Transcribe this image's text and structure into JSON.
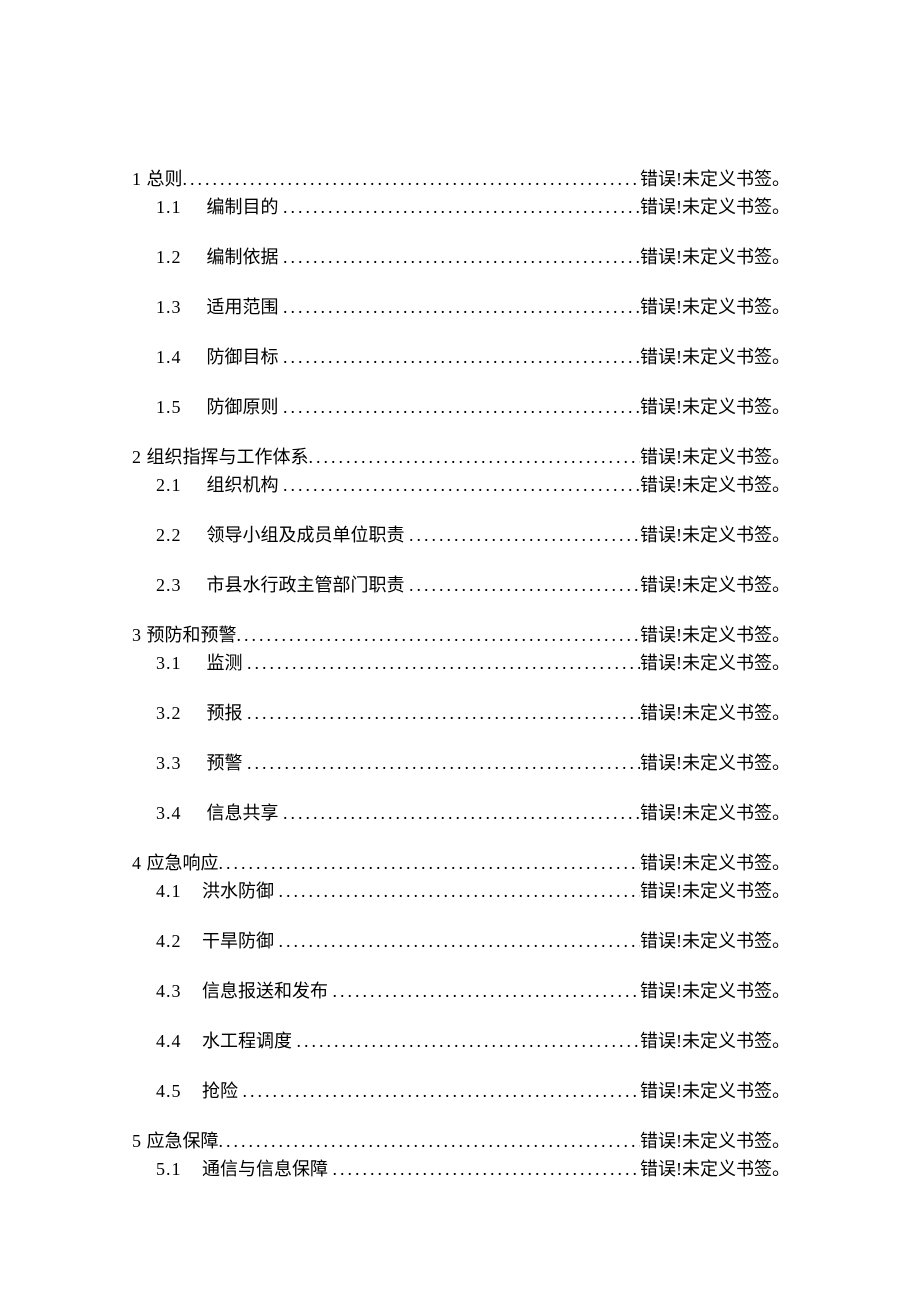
{
  "pageref_text": "错误!未定义书签。",
  "toc": [
    {
      "num": "1",
      "title": "总则",
      "level": 1
    },
    {
      "num": "1.1",
      "title": "编制目的",
      "level": 2
    },
    {
      "num": "1.2",
      "title": "编制依据",
      "level": 2
    },
    {
      "num": "1.3",
      "title": "适用范围",
      "level": 2
    },
    {
      "num": "1.4",
      "title": "防御目标",
      "level": 2
    },
    {
      "num": "1.5",
      "title": "防御原则",
      "level": 2
    },
    {
      "num": "2",
      "title": "组织指挥与工作体系",
      "level": 1
    },
    {
      "num": "2.1",
      "title": "组织机构",
      "level": 2
    },
    {
      "num": "2.2",
      "title": "领导小组及成员单位职责",
      "level": 2
    },
    {
      "num": "2.3",
      "title": "市县水行政主管部门职责",
      "level": 2
    },
    {
      "num": "3",
      "title": "预防和预警",
      "level": 1
    },
    {
      "num": "3.1",
      "title": "监测",
      "level": 2
    },
    {
      "num": "3.2",
      "title": "预报",
      "level": 2
    },
    {
      "num": "3.3",
      "title": "预警",
      "level": 2
    },
    {
      "num": "3.4",
      "title": "信息共享",
      "level": 2
    },
    {
      "num": "4",
      "title": "应急响应",
      "level": 1
    },
    {
      "num": "4.1",
      "title": "洪水防御",
      "level": 2,
      "tight": true
    },
    {
      "num": "4.2",
      "title": "干旱防御",
      "level": 2,
      "tight": true
    },
    {
      "num": "4.3",
      "title": "信息报送和发布",
      "level": 2,
      "tight": true
    },
    {
      "num": "4.4",
      "title": "水工程调度",
      "level": 2,
      "tight": true
    },
    {
      "num": "4.5",
      "title": "抢险",
      "level": 2,
      "tight": true
    },
    {
      "num": "5",
      "title": "应急保障",
      "level": 1
    },
    {
      "num": "5.1",
      "title": "通信与信息保障",
      "level": 2,
      "tight": true
    }
  ]
}
